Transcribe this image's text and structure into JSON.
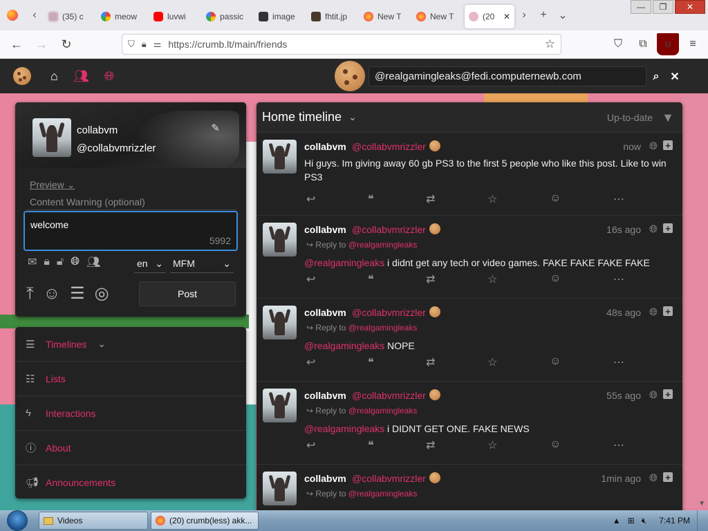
{
  "browser": {
    "tabs": [
      {
        "label": "(35) c",
        "favicon": "blurred-avatar"
      },
      {
        "label": "meow",
        "favicon": "google-icon"
      },
      {
        "label": "luvwi",
        "favicon": "youtube-icon"
      },
      {
        "label": "passic",
        "favicon": "google-icon"
      },
      {
        "label": "image",
        "favicon": "page-icon"
      },
      {
        "label": "fhtit.jp",
        "favicon": "page-icon"
      },
      {
        "label": "New T",
        "favicon": "firefox-icon"
      },
      {
        "label": "New T",
        "favicon": "firefox-icon"
      },
      {
        "label": "(20",
        "favicon": "blurred-avatar",
        "active": true
      }
    ],
    "url": "https://crumb.lt/main/friends"
  },
  "app": {
    "search_value": "@realgamingleaks@fedi.computernewb.com",
    "colors": {
      "accent": "#e0316b",
      "background": "#222222",
      "focus": "#3b8ddf"
    }
  },
  "composer": {
    "display_name": "collabvm",
    "handle": "@collabvmrizzler",
    "preview_label": "Preview",
    "cw_placeholder": "Content Warning (optional)",
    "text": "welcome",
    "char_count": "5992",
    "language": "en",
    "format": "MFM",
    "post_label": "Post"
  },
  "nav": {
    "items": [
      {
        "label": "Timelines",
        "icon": "bars-icon"
      },
      {
        "label": "Lists",
        "icon": "list-icon"
      },
      {
        "label": "Interactions",
        "icon": "bolt-icon"
      },
      {
        "label": "About",
        "icon": "info-icon"
      },
      {
        "label": "Announcements",
        "icon": "megaphone-icon"
      }
    ]
  },
  "timeline": {
    "title": "Home timeline",
    "status": "Up-to-date",
    "reply_prefix": "Reply to",
    "statuses": [
      {
        "name": "collabvm",
        "acct": "@collabvmrizzler",
        "time": "now",
        "reply_to": "",
        "mention": "",
        "text": "Hi guys. Im giving away 60 gb PS3 to the first 5 people who like this post. Like to win PS3"
      },
      {
        "name": "collabvm",
        "acct": "@collabvmrizzler",
        "time": "16s ago",
        "reply_to": "@realgamingleaks",
        "mention": "@realgamingleaks",
        "text": " i didnt get any tech or video games. FAKE FAKE FAKE FAKE"
      },
      {
        "name": "collabvm",
        "acct": "@collabvmrizzler",
        "time": "48s ago",
        "reply_to": "@realgamingleaks",
        "mention": "@realgamingleaks",
        "text": " NOPE"
      },
      {
        "name": "collabvm",
        "acct": "@collabvmrizzler",
        "time": "55s ago",
        "reply_to": "@realgamingleaks",
        "mention": "@realgamingleaks",
        "text": " i DIDNT GET ONE. FAKE NEWS"
      },
      {
        "name": "collabvm",
        "acct": "@collabvmrizzler",
        "time": "1min ago",
        "reply_to": "@realgamingleaks",
        "mention": "",
        "text": ""
      }
    ]
  },
  "taskbar": {
    "items": [
      {
        "label": "Videos"
      },
      {
        "label": "(20) crumb(less) akk..."
      }
    ],
    "clock": "7:41 PM"
  }
}
